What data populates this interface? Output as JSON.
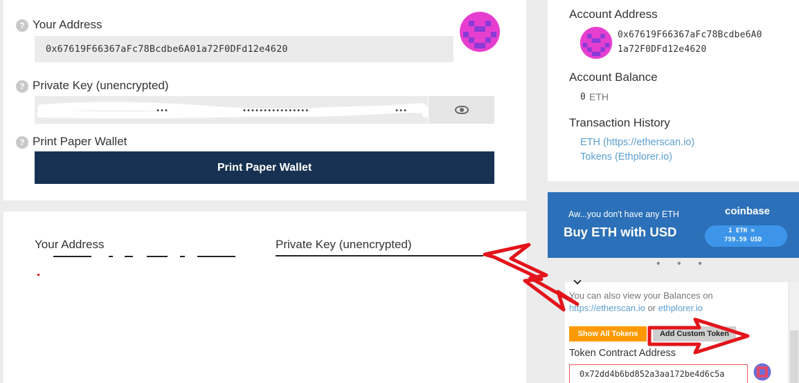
{
  "wallet": {
    "your_address_label": "Your Address",
    "your_address_value": "0x67619F66367aFc78Bcdbe6A01a72F0DFd12e4620",
    "private_key_label": "Private Key (unencrypted)",
    "print_label": "Print Paper Wallet",
    "print_button": "Print Paper Wallet",
    "help_icon_glyph": "?"
  },
  "paper": {
    "your_address_label": "Your Address",
    "private_key_label": "Private Key (unencrypted)"
  },
  "sidebar": {
    "account_address_label": "Account Address",
    "account_address_line1": "0x67619F66367aFc78Bcdbe6A0",
    "account_address_line2": "1a72F0DFd12e4620",
    "account_balance_label": "Account Balance",
    "balance_amount": "0",
    "balance_unit": "ETH",
    "tx_history_label": "Transaction History",
    "tx_link_eth": "ETH (https://etherscan.io)",
    "tx_link_tokens": "Tokens (Ethplorer.io)"
  },
  "coinbase": {
    "tagline": "Aw...you don't have any ETH",
    "brand": "coinbase",
    "cta": "Buy ETH with USD",
    "rate_line1": "1 ETH ≈",
    "rate_line2": "759.59 USD",
    "carousel_dots": "• • •"
  },
  "tokens": {
    "balances_note_1": "You can also view your Balances on",
    "balances_note_link1": "https://etherscan.io",
    "balances_note_or": " or ",
    "balances_note_link2": "ethplorer.io",
    "show_all_button": "Show All Tokens",
    "add_custom_button": "Add Custom Token",
    "contract_label": "Token Contract Address",
    "contract_value": "0x72dd4b6bd852a3aa172be4d6c5a"
  },
  "colors": {
    "dark_button": "#163151",
    "coinbase_blue": "#2b70b8",
    "orange_button": "#ff9900",
    "link_blue": "#5a9fd0",
    "annotation_red": "#e3141b",
    "identicon_pink": "#e63fd0",
    "identicon_purple": "#8a3bd6"
  }
}
